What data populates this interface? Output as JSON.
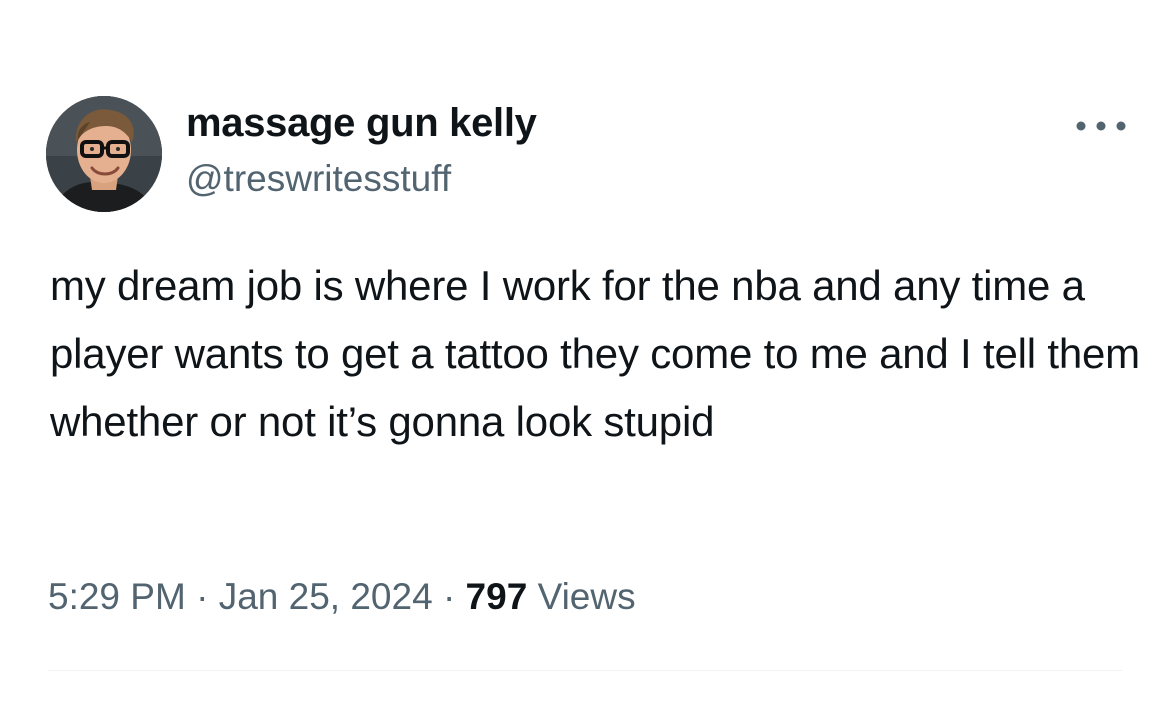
{
  "author": {
    "display_name": "massage gun kelly",
    "handle": "@treswritesstuff"
  },
  "post": {
    "text": "my dream job is where I work for the nba and any time a player wants to get a tattoo they come to me and I tell them whether or not it’s gonna look stupid"
  },
  "meta": {
    "time": "5:29 PM",
    "separator": "·",
    "date": "Jan 25, 2024",
    "views_count": "797",
    "views_label": "Views"
  },
  "icons": {
    "more": "more-horizontal-icon"
  },
  "colors": {
    "text_primary": "#0f1419",
    "text_secondary": "#536471",
    "divider": "#eff3f4",
    "background": "#ffffff"
  }
}
